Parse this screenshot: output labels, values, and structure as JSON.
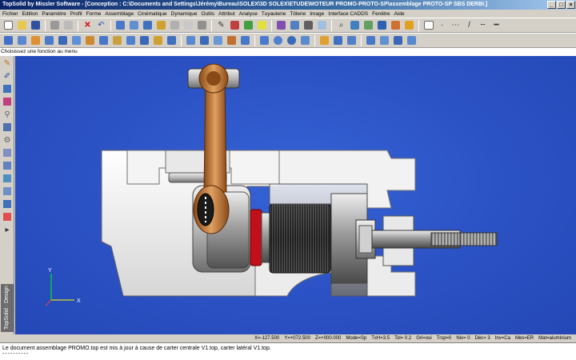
{
  "window": {
    "title": "TopSolid by Missler Software - [Conception : C:\\Documents and Settings\\Jérémy\\Bureau\\SOLEX\\3D SOLEX\\ETUDE\\MOTEUR PROMO-PROTO-SP\\assemblage PROTO-SP SBS DERBI.]"
  },
  "menu": [
    "Fichier",
    "Edition",
    "Paramètre",
    "Profil",
    "Forme",
    "Assemblage",
    "Cinématique",
    "Dynamique",
    "Outils",
    "Attribut",
    "Analyse",
    "Tuyauterie",
    "Tôlerie",
    "Image",
    "Interface CADDS",
    "Fenêtre",
    "Aide"
  ],
  "hint": "Choisissez une fonction au menu",
  "brand": "TopSolid · Design",
  "axes": {
    "y": "Y",
    "x": "X"
  },
  "status": {
    "x": "X=-127.500",
    "y": "Y=+072.500",
    "z": "Z=+000.000",
    "mode": "Mode=Sp",
    "txh": "TxH=3.5",
    "tol": "Tol=  0.2",
    "gri": "Gri=oui",
    "trsp": "Trsp=0",
    "niv": "Niv=  0",
    "dec": "Déc= 3",
    "inv": "Inv=Ca",
    "mes": "Mes=ER",
    "mat": "Mat=aluminium"
  },
  "message": "Le document assemblage PROMO.top est mis à jour à cause de carter centrale V1.top, carter latéral V1.top.",
  "message_dashes": "----------",
  "colors": {
    "viewport": "#2b55c8",
    "accent": "#0a246a"
  }
}
